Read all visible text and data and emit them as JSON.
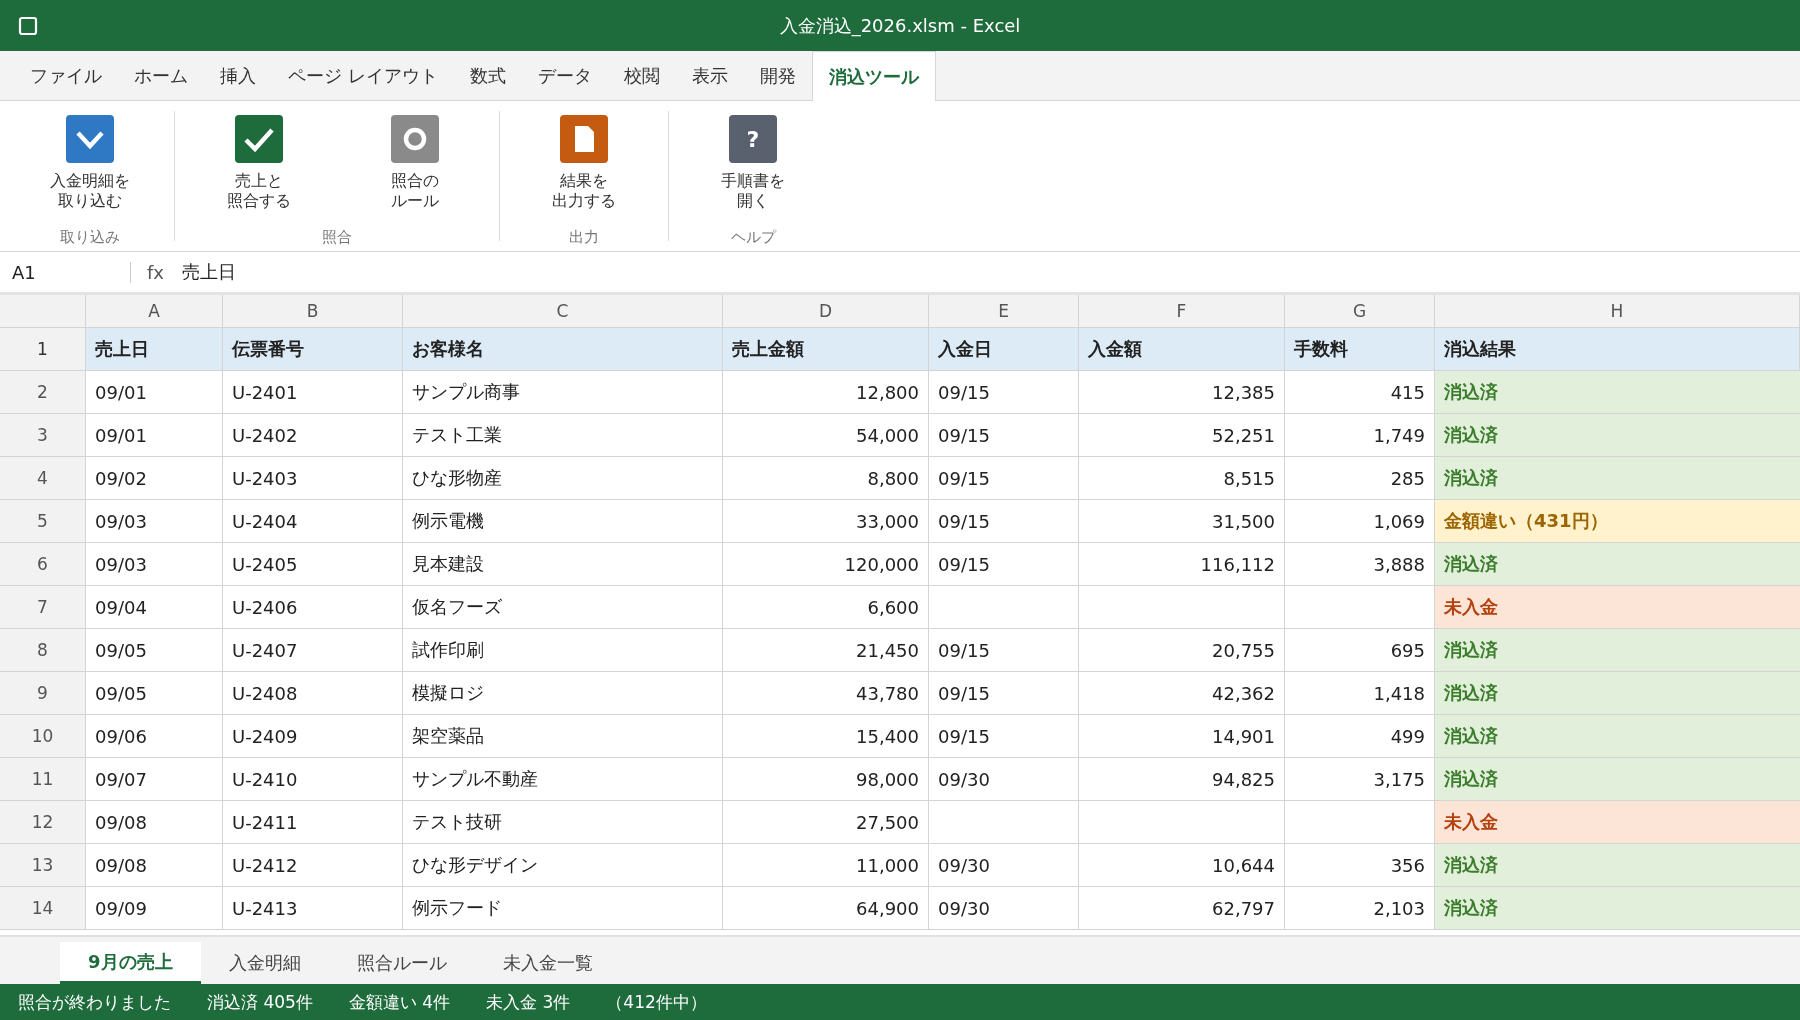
{
  "window": {
    "title": "入金消込_2026.xlsm - Excel"
  },
  "menu_tabs": [
    {
      "label": "ファイル",
      "selected": false
    },
    {
      "label": "ホーム",
      "selected": false
    },
    {
      "label": "挿入",
      "selected": false
    },
    {
      "label": "ページ レイアウト",
      "selected": false
    },
    {
      "label": "数式",
      "selected": false
    },
    {
      "label": "データ",
      "selected": false
    },
    {
      "label": "校閲",
      "selected": false
    },
    {
      "label": "表示",
      "selected": false
    },
    {
      "label": "開発",
      "selected": false
    },
    {
      "label": "消込ツール",
      "selected": true
    }
  ],
  "ribbon": {
    "groups": [
      {
        "label": "取り込み",
        "buttons": [
          {
            "kind": "import",
            "lines": [
              "入金明細を",
              "取り込む"
            ]
          }
        ]
      },
      {
        "label": "照合",
        "buttons": [
          {
            "kind": "match",
            "lines": [
              "売上と",
              "照合する"
            ]
          },
          {
            "kind": "rules",
            "lines": [
              "照合の",
              "ルール"
            ]
          }
        ]
      },
      {
        "label": "出力",
        "buttons": [
          {
            "kind": "export",
            "lines": [
              "結果を",
              "出力する"
            ]
          }
        ]
      },
      {
        "label": "ヘルプ",
        "buttons": [
          {
            "kind": "help",
            "glyph": "?",
            "lines": [
              "手順書を",
              "開く"
            ]
          }
        ]
      }
    ]
  },
  "formula_bar": {
    "cell": "A1",
    "fx": "fx",
    "value": "売上日"
  },
  "columns": [
    "A",
    "B",
    "C",
    "D",
    "E",
    "F",
    "G",
    "H"
  ],
  "header_row": {
    "number": "1",
    "cells": [
      "売上日",
      "伝票番号",
      "お客様名",
      "売上金額",
      "入金日",
      "入金額",
      "手数料",
      "消込結果"
    ]
  },
  "rows": [
    {
      "number": "2",
      "cells": [
        "09/01",
        "U-2401",
        "サンプル商事",
        "12,800",
        "09/15",
        "12,385",
        "415"
      ],
      "result": {
        "text": "消込済",
        "kind": "ok"
      }
    },
    {
      "number": "3",
      "cells": [
        "09/01",
        "U-2402",
        "テスト工業",
        "54,000",
        "09/15",
        "52,251",
        "1,749"
      ],
      "result": {
        "text": "消込済",
        "kind": "ok"
      }
    },
    {
      "number": "4",
      "cells": [
        "09/02",
        "U-2403",
        "ひな形物産",
        "8,800",
        "09/15",
        "8,515",
        "285"
      ],
      "result": {
        "text": "消込済",
        "kind": "ok"
      }
    },
    {
      "number": "5",
      "cells": [
        "09/03",
        "U-2404",
        "例示電機",
        "33,000",
        "09/15",
        "31,500",
        "1,069"
      ],
      "result": {
        "text": "金額違い（431円）",
        "kind": "mismatch"
      }
    },
    {
      "number": "6",
      "cells": [
        "09/03",
        "U-2405",
        "見本建設",
        "120,000",
        "09/15",
        "116,112",
        "3,888"
      ],
      "result": {
        "text": "消込済",
        "kind": "ok"
      }
    },
    {
      "number": "7",
      "cells": [
        "09/04",
        "U-2406",
        "仮名フーズ",
        "6,600",
        "",
        "",
        ""
      ],
      "result": {
        "text": "未入金",
        "kind": "unpaid"
      }
    },
    {
      "number": "8",
      "cells": [
        "09/05",
        "U-2407",
        "試作印刷",
        "21,450",
        "09/15",
        "20,755",
        "695"
      ],
      "result": {
        "text": "消込済",
        "kind": "ok"
      }
    },
    {
      "number": "9",
      "cells": [
        "09/05",
        "U-2408",
        "模擬ロジ",
        "43,780",
        "09/15",
        "42,362",
        "1,418"
      ],
      "result": {
        "text": "消込済",
        "kind": "ok"
      }
    },
    {
      "number": "10",
      "cells": [
        "09/06",
        "U-2409",
        "架空薬品",
        "15,400",
        "09/15",
        "14,901",
        "499"
      ],
      "result": {
        "text": "消込済",
        "kind": "ok"
      }
    },
    {
      "number": "11",
      "cells": [
        "09/07",
        "U-2410",
        "サンプル不動産",
        "98,000",
        "09/30",
        "94,825",
        "3,175"
      ],
      "result": {
        "text": "消込済",
        "kind": "ok"
      }
    },
    {
      "number": "12",
      "cells": [
        "09/08",
        "U-2411",
        "テスト技研",
        "27,500",
        "",
        "",
        ""
      ],
      "result": {
        "text": "未入金",
        "kind": "unpaid"
      }
    },
    {
      "number": "13",
      "cells": [
        "09/08",
        "U-2412",
        "ひな形デザイン",
        "11,000",
        "09/30",
        "10,644",
        "356"
      ],
      "result": {
        "text": "消込済",
        "kind": "ok"
      }
    },
    {
      "number": "14",
      "cells": [
        "09/09",
        "U-2413",
        "例示フード",
        "64,900",
        "09/30",
        "62,797",
        "2,103"
      ],
      "result": {
        "text": "消込済",
        "kind": "ok"
      }
    }
  ],
  "sheet_tabs": [
    {
      "label": "9月の売上",
      "selected": true
    },
    {
      "label": "入金明細",
      "selected": false
    },
    {
      "label": "照合ルール",
      "selected": false
    },
    {
      "label": "未入金一覧",
      "selected": false
    }
  ],
  "status_bar": [
    "照合が終わりました",
    "消込済 405件",
    "金額違い 4件",
    "未入金 3件",
    "（412件中）"
  ]
}
